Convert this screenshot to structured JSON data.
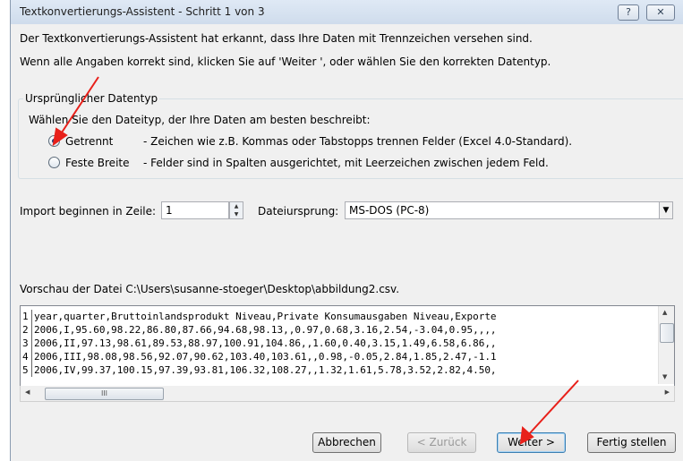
{
  "window": {
    "title": "Textkonvertierungs-Assistent - Schritt 1 von 3",
    "help_label": "?",
    "close_label": "✕"
  },
  "intro": {
    "line1": "Der Textkonvertierungs-Assistent hat erkannt, dass Ihre Daten mit Trennzeichen versehen sind.",
    "line2": "Wenn alle Angaben korrekt sind, klicken Sie auf 'Weiter ', oder wählen Sie den korrekten Datentyp."
  },
  "datatype_group": {
    "label": "Ursprünglicher Datentyp",
    "prompt": "Wählen Sie den Dateityp, der Ihre Daten am besten beschreibt:",
    "options": [
      {
        "label": "Getrennt",
        "description": "- Zeichen wie z.B. Kommas oder Tabstopps trennen Felder (Excel 4.0-Standard).",
        "checked": true
      },
      {
        "label": "Feste Breite",
        "description": "- Felder sind in Spalten ausgerichtet, mit Leerzeichen zwischen jedem Feld.",
        "checked": false
      }
    ]
  },
  "import_row": {
    "start_label": "Import beginnen in Zeile:",
    "start_value": "1",
    "origin_label": "Dateiursprung:",
    "origin_value": "MS-DOS (PC-8)"
  },
  "preview": {
    "label": "Vorschau der Datei C:\\Users\\susanne-stoeger\\Desktop\\abbildung2.csv.",
    "rows": [
      {
        "num": "1",
        "text": "year,quarter,Bruttoinlandsprodukt Niveau,Private Konsumausgaben Niveau,Exporte"
      },
      {
        "num": "2",
        "text": "2006,I,95.60,98.22,86.80,87.66,94.68,98.13,,0.97,0.68,3.16,2.54,-3.04,0.95,,,,"
      },
      {
        "num": "3",
        "text": "2006,II,97.13,98.61,89.53,88.97,100.91,104.86,,1.60,0.40,3.15,1.49,6.58,6.86,,"
      },
      {
        "num": "4",
        "text": "2006,III,98.08,98.56,92.07,90.62,103.40,103.61,,0.98,-0.05,2.84,1.85,2.47,-1.1"
      },
      {
        "num": "5",
        "text": "2006,IV,99.37,100.15,97.39,93.81,106.32,108.27,,1.32,1.61,5.78,3.52,2.82,4.50,"
      }
    ],
    "hscroll_grip": "III"
  },
  "buttons": {
    "cancel": "Abbrechen",
    "back": "< Zurück",
    "next": "Weiter >",
    "finish": "Fertig stellen"
  },
  "colors": {
    "annotation_arrow": "#e8201a",
    "titlebar": "#d6e2f0"
  }
}
